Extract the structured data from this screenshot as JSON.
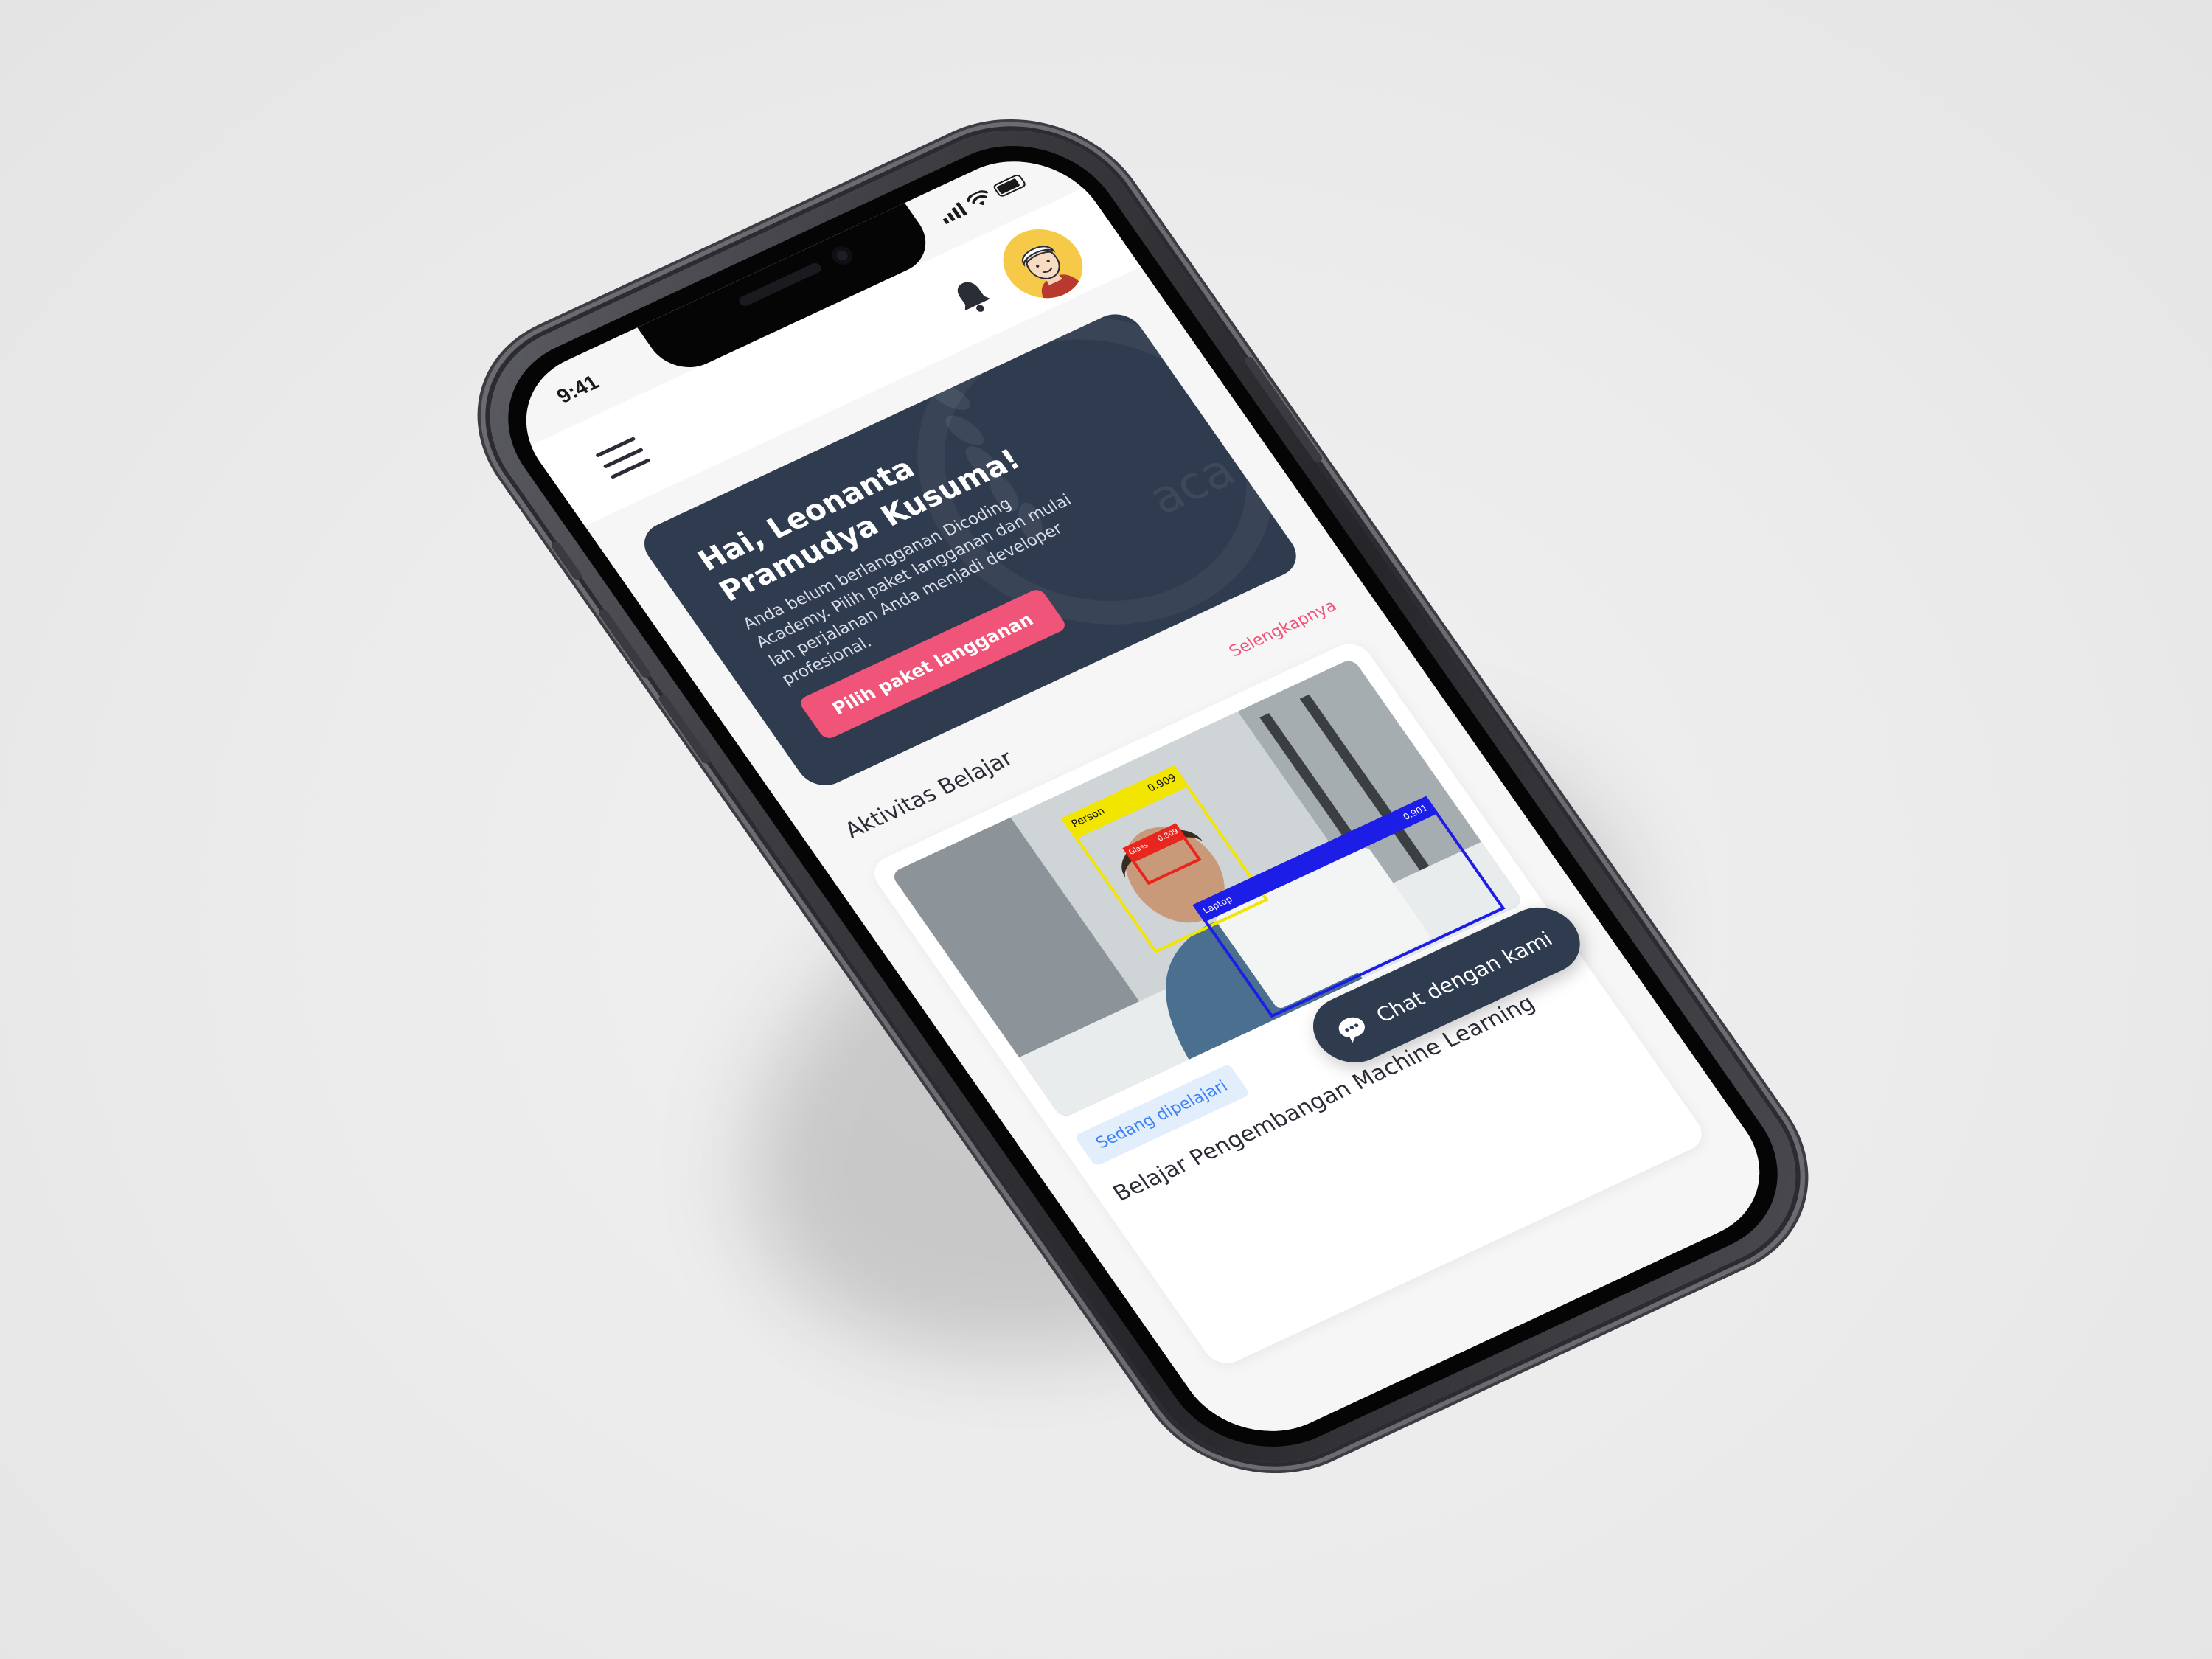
{
  "status_bar": {
    "time": "9:41"
  },
  "header": {
    "menu_icon": "hamburger-menu-icon",
    "notification_icon": "bell-icon",
    "avatar_icon": "user-avatar"
  },
  "hero": {
    "greeting": "Hai, Leonanta Pramudya Kusuma!",
    "description": "Anda belum berlangganan Dicoding Academy. Pilih paket langganan dan mulai lah perjalanan Anda menjadi developer profesional.",
    "cta_label": "Pilih paket langganan",
    "watermark_text": "aca"
  },
  "learning": {
    "section_title": "Aktivitas Belajar",
    "see_more": "Selengkapnya",
    "course": {
      "status_badge": "Sedang dipelajari",
      "title": "Belajar Pengembangan Machine Learning",
      "image_labels": {
        "person": "Person",
        "person_score": "0.909",
        "glass": "Glass",
        "glass_score": "0.809",
        "laptop": "Laptop",
        "laptop_score": "0.901"
      }
    }
  },
  "chat": {
    "label": "Chat dengan kami",
    "icon": "chat-bubble-icon"
  },
  "colors": {
    "primary_dark": "#2f3b4f",
    "accent_pink": "#f05479",
    "badge_blue": "#3b82f6",
    "background": "#ececec"
  }
}
